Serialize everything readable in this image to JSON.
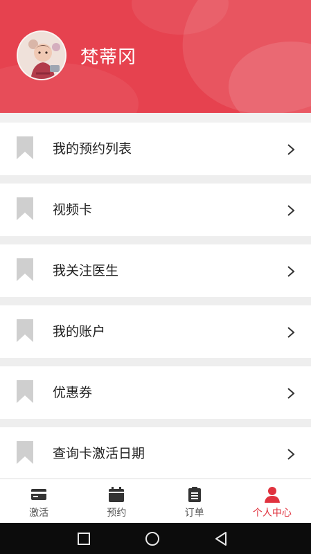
{
  "profile": {
    "name": "梵蒂冈"
  },
  "menu": {
    "items": [
      {
        "label": "我的预约列表"
      },
      {
        "label": "视频卡"
      },
      {
        "label": "我关注医生"
      },
      {
        "label": "我的账户"
      },
      {
        "label": "优惠券"
      },
      {
        "label": "查询卡激活日期"
      }
    ]
  },
  "tabbar": {
    "tabs": [
      {
        "label": "激活",
        "icon": "card-icon"
      },
      {
        "label": "预约",
        "icon": "calendar-icon"
      },
      {
        "label": "订单",
        "icon": "clipboard-icon"
      },
      {
        "label": "个人中心",
        "icon": "person-icon"
      }
    ],
    "active_index": 3
  },
  "colors": {
    "header": "#e6424f",
    "active_tab": "#e0323e",
    "bookmark": "#cfcfcf"
  }
}
